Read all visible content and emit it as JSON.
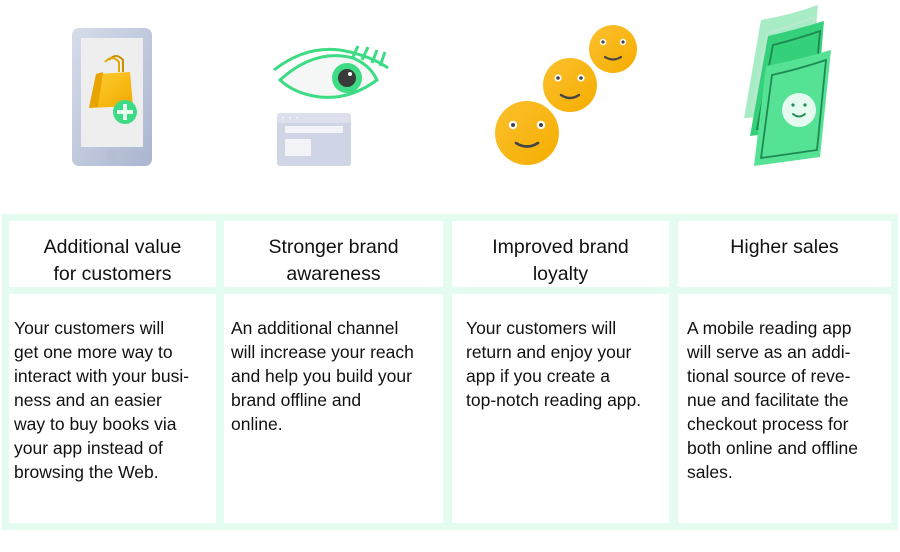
{
  "colors": {
    "grid_border": "#e3fcef",
    "accent_green": "#3ddc84",
    "smiley_yellow": "#fbb814",
    "device_gray": "#c5cde0"
  },
  "columns": [
    {
      "icon": "phone-shopping-bag-icon",
      "title_lines": [
        "Additional value",
        "for customers"
      ],
      "body_lines": [
        "Your customers will",
        "get one more way to",
        "interact with your busi-",
        "ness and an easier",
        "way to buy books via",
        "your app instead of",
        "browsing the Web."
      ]
    },
    {
      "icon": "eye-browser-window-icon",
      "title_lines": [
        "Stronger brand",
        "awareness"
      ],
      "body_lines": [
        "An additional channel",
        "will increase your reach",
        "and help you build your",
        "brand offline and",
        "online."
      ]
    },
    {
      "icon": "smiley-faces-icon",
      "title_lines": [
        "Improved brand",
        "loyalty"
      ],
      "body_lines": [
        "Your customers will",
        "return and enjoy your",
        "app if you create a",
        "top-notch reading app."
      ]
    },
    {
      "icon": "money-bills-icon",
      "title_lines": [
        "Higher sales"
      ],
      "body_lines": [
        "A mobile reading app",
        "will serve as an addi-",
        "tional source of reve-",
        "nue and facilitate the",
        "checkout process for",
        "both online and offline",
        "sales."
      ]
    }
  ]
}
